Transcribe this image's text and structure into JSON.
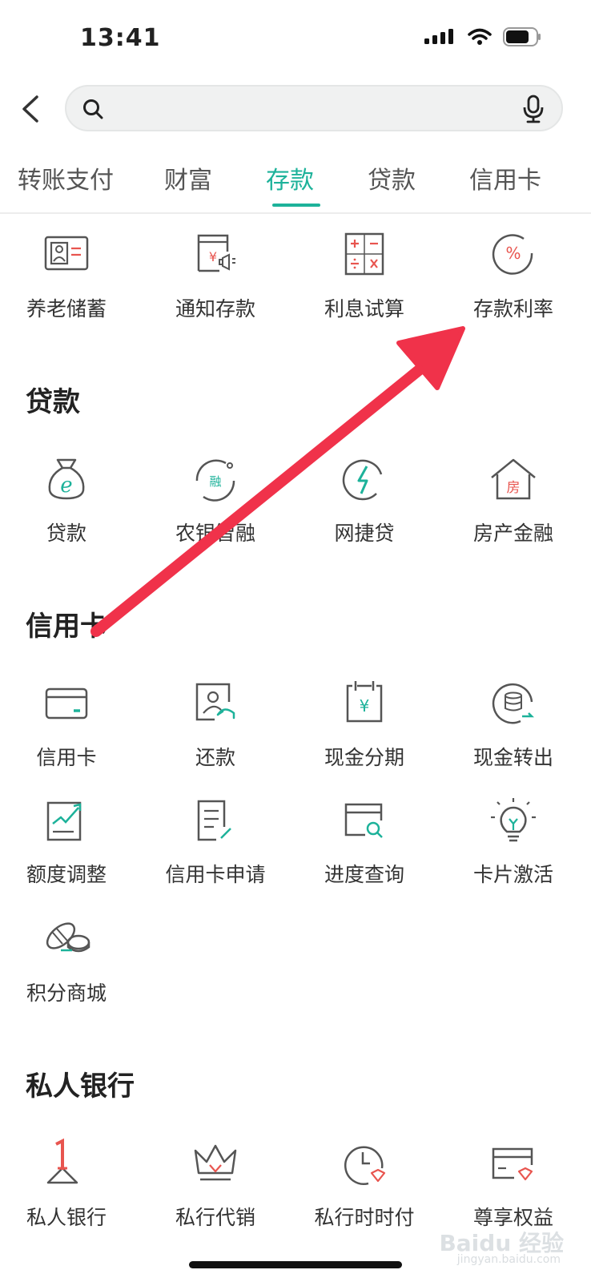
{
  "status_bar": {
    "time": "13:41"
  },
  "tabs": [
    {
      "label": "转账支付",
      "active": false
    },
    {
      "label": "财富",
      "active": false
    },
    {
      "label": "存款",
      "active": true
    },
    {
      "label": "贷款",
      "active": false
    },
    {
      "label": "信用卡",
      "active": false
    }
  ],
  "deposit_items": [
    {
      "label": "养老储蓄",
      "icon": "pension-card-icon"
    },
    {
      "label": "通知存款",
      "icon": "notice-deposit-icon"
    },
    {
      "label": "利息试算",
      "icon": "calculator-icon"
    },
    {
      "label": "存款利率",
      "icon": "percent-icon"
    }
  ],
  "loan_section": {
    "title": "贷款",
    "items": [
      {
        "label": "贷款",
        "icon": "money-bag-icon"
      },
      {
        "label": "农银智融",
        "icon": "rong-cycle-icon"
      },
      {
        "label": "网捷贷",
        "icon": "lightning-icon"
      },
      {
        "label": "房产金融",
        "icon": "house-icon"
      }
    ]
  },
  "credit_section": {
    "title": "信用卡",
    "items": [
      {
        "label": "信用卡",
        "icon": "credit-card-icon"
      },
      {
        "label": "还款",
        "icon": "repayment-icon"
      },
      {
        "label": "现金分期",
        "icon": "calendar-yuan-icon"
      },
      {
        "label": "现金转出",
        "icon": "coins-transfer-icon"
      },
      {
        "label": "额度调整",
        "icon": "limit-chart-icon"
      },
      {
        "label": "信用卡申请",
        "icon": "application-form-icon"
      },
      {
        "label": "进度查询",
        "icon": "progress-search-icon"
      },
      {
        "label": "卡片激活",
        "icon": "lightbulb-icon"
      },
      {
        "label": "积分商城",
        "icon": "points-coins-icon"
      }
    ]
  },
  "private_section": {
    "title": "私人银行",
    "items": [
      {
        "label": "私人银行",
        "icon": "private-bank-one-icon"
      },
      {
        "label": "私行代销",
        "icon": "crown-icon"
      },
      {
        "label": "私行时时付",
        "icon": "clock-diamond-icon"
      },
      {
        "label": "尊享权益",
        "icon": "card-diamond-icon"
      }
    ]
  },
  "watermark": {
    "text": "Baidu 经验",
    "sub": "jingyan.baidu.com"
  },
  "colors": {
    "accent": "#1db29a",
    "icon_red": "#e8554f",
    "icon_gray": "#555555",
    "arrow": "#f0324a"
  }
}
